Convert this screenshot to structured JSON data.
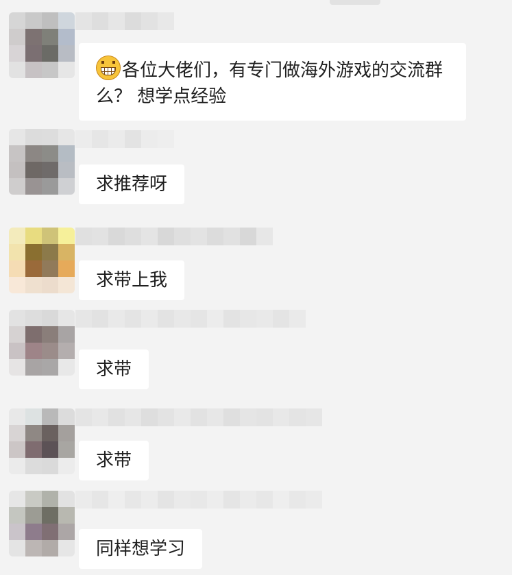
{
  "messages": [
    {
      "emoji": "grinning-face-icon",
      "text": "各位大佬们，有专门做海外游戏的交流群么？ 想学点经验",
      "avatar_colors": [
        "#d6d6d6",
        "#c9c9c9",
        "#bfbfbf",
        "#cfd6dd",
        "#cfcccc",
        "#7d7272",
        "#7f8079",
        "#b3bccb",
        "#d8d4d6",
        "#7b6f72",
        "#6b6b66",
        "#b8bcc4",
        "#e2e2e2",
        "#c7c2c4",
        "#c7c7c7",
        "#e6e6e6"
      ],
      "name_colors": [
        "#e4e4e4",
        "#dedede",
        "#e6e6e6",
        "#dcdcdc",
        "#e2e2e2",
        "#e8e8e8"
      ]
    },
    {
      "text": "求推荐呀",
      "avatar_colors": [
        "#e6e6e6",
        "#dcdcdc",
        "#dddddd",
        "#e6e6e6",
        "#c7c4c4",
        "#8c8784",
        "#8c8c88",
        "#b4bcc4",
        "#c4c0c0",
        "#6e6865",
        "#6f6b6a",
        "#b9bdc3",
        "#cfcdcd",
        "#999393",
        "#9a9a9a",
        "#cfd0d3"
      ],
      "name_colors": [
        "#ececec",
        "#e6e6e6",
        "#ebebeb",
        "#e3e3e3",
        "#ececec",
        "#eeeeee"
      ]
    },
    {
      "text": "求带上我",
      "avatar_colors": [
        "#f3ebbc",
        "#e8dc80",
        "#cfc378",
        "#f6f09a",
        "#f2e3ad",
        "#8a6f30",
        "#8c7a4a",
        "#d8b464",
        "#f5dcb4",
        "#9a6a3a",
        "#917a5a",
        "#e6aa5a",
        "#f8e8d8",
        "#efe0cf",
        "#ecdccc",
        "#f4e6d6"
      ],
      "name_colors": [
        "#e0e0e0",
        "#e2e2e2",
        "#d9d9d9",
        "#dedede",
        "#e4e4e4",
        "#d8d8d8",
        "#dfdfdf",
        "#e3e3e3",
        "#dcdcdc",
        "#e1e1e1",
        "#d8d8d8",
        "#e7e7e7"
      ]
    },
    {
      "text": "求带",
      "avatar_colors": [
        "#e2e2e2",
        "#dddddd",
        "#d9d9d9",
        "#e6e6e6",
        "#d6d2d2",
        "#7e6e6e",
        "#8a7e7a",
        "#a8a4a4",
        "#c9c2c4",
        "#9e8488",
        "#9b8c8a",
        "#b4aeae",
        "#e6e4e4",
        "#a8a4a4",
        "#a9a7a7",
        "#e8e8e8"
      ],
      "name_colors": [
        "#e6e6e6",
        "#e2e2e2",
        "#e9e9e9",
        "#e4e4e4",
        "#eaeaea",
        "#e3e3e3",
        "#e8e8e8",
        "#e5e5e5",
        "#ececec",
        "#e3e3e3",
        "#e7e7e7",
        "#e9e9e9",
        "#e4e4e4",
        "#eaeaea"
      ]
    },
    {
      "text": "求带",
      "avatar_colors": [
        "#e8e8e8",
        "#dde2e2",
        "#b9b9b9",
        "#dcdcdc",
        "#d8d4d4",
        "#8f8884",
        "#6a615f",
        "#a4a09d",
        "#ccc6c6",
        "#7f6c70",
        "#5c5256",
        "#a8a6a2",
        "#ebebeb",
        "#dcdcdc",
        "#dadada",
        "#ececec"
      ],
      "name_colors": [
        "#e4e4e4",
        "#e8e8e8",
        "#e1e1e1",
        "#e6e6e6",
        "#dedede",
        "#e3e3e3",
        "#e9e9e9",
        "#e2e2e2",
        "#e7e7e7",
        "#dfdfdf",
        "#e5e5e5",
        "#e3e3e3",
        "#e8e8e8",
        "#e4e4e4",
        "#e6e6e6"
      ]
    },
    {
      "text": "同样想学习",
      "avatar_colors": [
        "#e6e6e6",
        "#c9cac4",
        "#b0b2aa",
        "#e2e2e2",
        "#c4c6c0",
        "#9c9c94",
        "#6e6e64",
        "#b8b8b0",
        "#cac4ca",
        "#8e7c8c",
        "#806f74",
        "#aca6a6",
        "#e4e4e4",
        "#bcb6b4",
        "#b1aba8",
        "#e6e6e6"
      ],
      "name_colors": [
        "#ebebeb",
        "#e6e6e6",
        "#eeeeee",
        "#e7e7e7",
        "#ececec",
        "#e4e4e4",
        "#eaeaea",
        "#e8e8e8",
        "#ededed",
        "#e5e5e5",
        "#ebebeb",
        "#e7e7e7",
        "#eeeeee",
        "#e8e8e8",
        "#ebebeb"
      ]
    }
  ]
}
